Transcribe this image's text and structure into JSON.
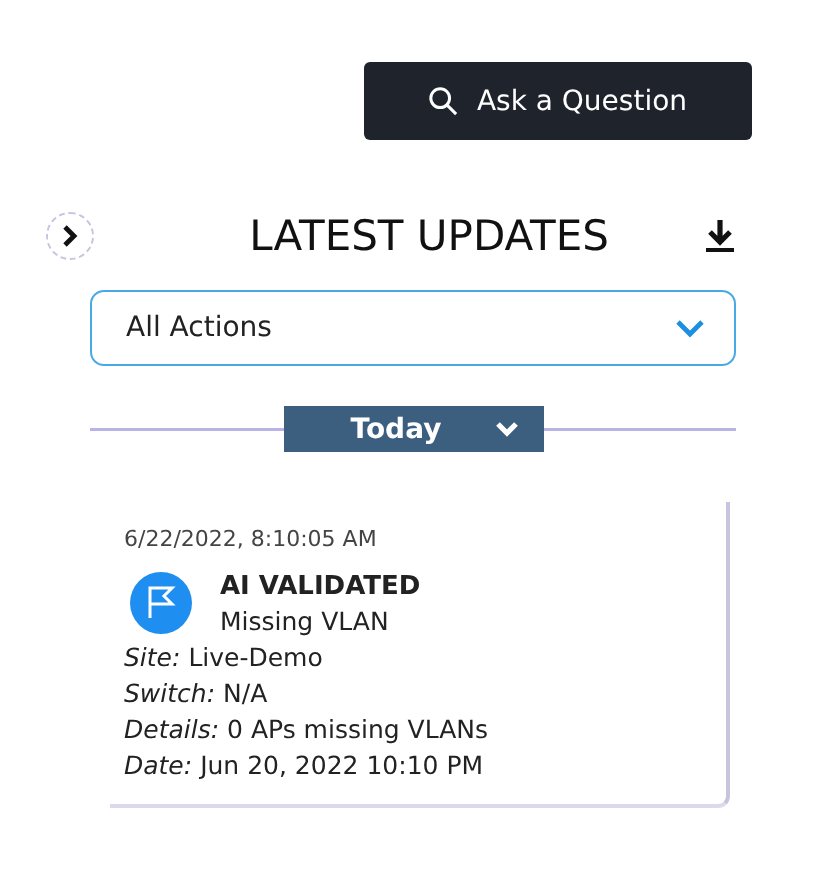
{
  "ask_button": {
    "label": "Ask a Question"
  },
  "panel": {
    "title": "LATEST UPDATES"
  },
  "filter": {
    "value": "All Actions"
  },
  "group": {
    "label": "Today",
    "expanded": true
  },
  "updates": [
    {
      "timestamp": "6/22/2022, 8:10:05 AM",
      "title": "AI VALIDATED",
      "subtitle": "Missing VLAN",
      "fields": [
        {
          "label": "Site:",
          "value": "Live-Demo"
        },
        {
          "label": "Switch:",
          "value": "N/A"
        },
        {
          "label": "Details:",
          "value": "0 APs missing VLANs"
        },
        {
          "label": "Date:",
          "value": "Jun 20, 2022 10:10 PM"
        }
      ]
    }
  ]
}
